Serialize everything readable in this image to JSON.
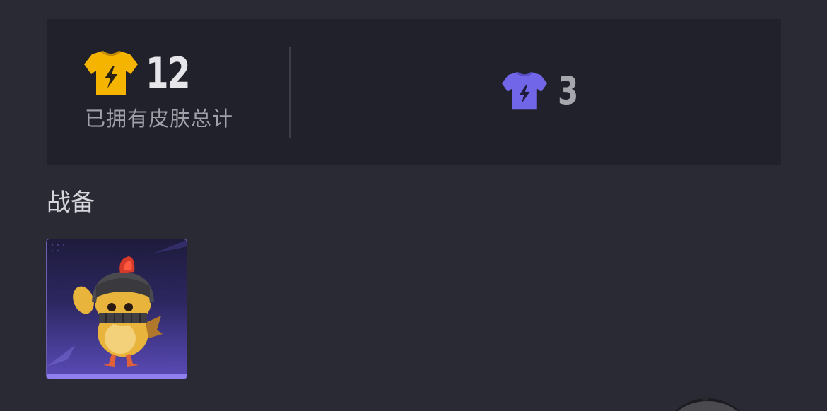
{
  "summary": {
    "total": {
      "icon": "gold-shirt-lightning-icon",
      "color": "#f5b400",
      "count": "12",
      "label": "已拥有皮肤总计"
    },
    "purple": {
      "icon": "purple-shirt-lightning-icon",
      "color": "#7266e8",
      "count": "3"
    }
  },
  "section": {
    "title": "战备"
  },
  "items": [
    {
      "name": "chicken-helmet-skin",
      "icon": "chicken-helmet-icon",
      "rarity_color": "#8f80f0"
    }
  ]
}
